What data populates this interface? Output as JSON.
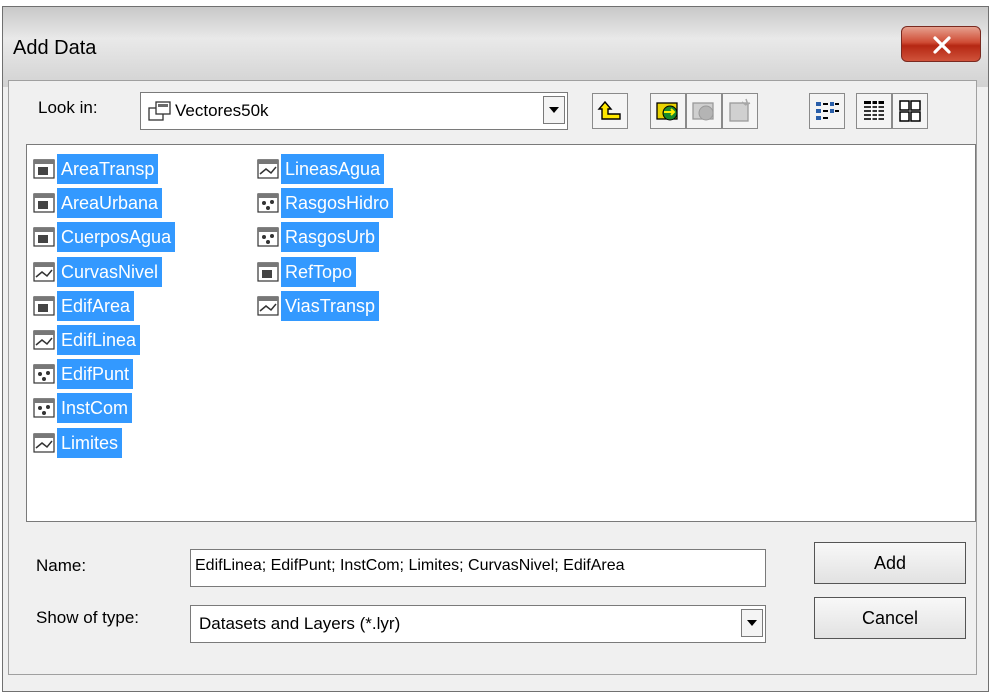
{
  "window": {
    "title": "Add Data",
    "close_icon": "close-icon"
  },
  "lookin": {
    "label": "Look in:",
    "value": "Vectores50k",
    "icon": "database-folder-icon"
  },
  "toolbar": {
    "icons": [
      "up-one-level-icon",
      "connect-folder-icon",
      "disconnect-folder-icon",
      "new-item-icon",
      "list-view-icon",
      "details-view-icon",
      "thumbnails-view-icon"
    ]
  },
  "items": [
    {
      "label": "AreaTransp",
      "icon": "polygon-featureclass-icon"
    },
    {
      "label": "AreaUrbana",
      "icon": "polygon-featureclass-icon"
    },
    {
      "label": "CuerposAgua",
      "icon": "polygon-featureclass-icon"
    },
    {
      "label": "CurvasNivel",
      "icon": "line-featureclass-icon"
    },
    {
      "label": "EdifArea",
      "icon": "polygon-featureclass-icon"
    },
    {
      "label": "EdifLinea",
      "icon": "line-featureclass-icon"
    },
    {
      "label": "EdifPunt",
      "icon": "point-featureclass-icon"
    },
    {
      "label": "InstCom",
      "icon": "point-featureclass-icon"
    },
    {
      "label": "Limites",
      "icon": "line-featureclass-icon"
    },
    {
      "label": "LineasAgua",
      "icon": "line-featureclass-icon"
    },
    {
      "label": "RasgosHidro",
      "icon": "point-featureclass-icon"
    },
    {
      "label": "RasgosUrb",
      "icon": "point-featureclass-icon"
    },
    {
      "label": "RefTopo",
      "icon": "polygon-featureclass-icon"
    },
    {
      "label": "ViasTransp",
      "icon": "line-featureclass-icon"
    }
  ],
  "name_field": {
    "label": "Name:",
    "value": "EdifLinea; EdifPunt; InstCom; Limites; CurvasNivel; EdifArea"
  },
  "type_field": {
    "label": "Show of type:",
    "value": "Datasets and Layers (*.lyr)"
  },
  "buttons": {
    "add": "Add",
    "cancel": "Cancel"
  },
  "colors": {
    "selection": "#3399ff",
    "close_button": "#c8432b"
  }
}
